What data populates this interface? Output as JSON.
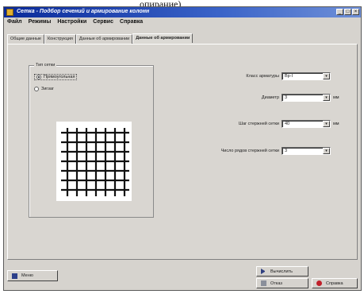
{
  "caption_fragment": "опирание)",
  "window": {
    "title": "Сетка - Подбор сечений и армирование колонн",
    "controls": [
      "_",
      "□",
      "×"
    ]
  },
  "menu": [
    "Файл",
    "Режимы",
    "Настройки",
    "Сервис",
    "Справка"
  ],
  "tabs": [
    {
      "label": "Общие данные",
      "active": false
    },
    {
      "label": "Конструкция",
      "active": false
    },
    {
      "label": "Данные об армировании",
      "active": false
    },
    {
      "label": "Данные об армировании",
      "active": true
    }
  ],
  "grid_type": {
    "label": "Тип сетки",
    "options": [
      {
        "label": "Прямоугольная",
        "checked": true
      },
      {
        "label": "Зигзаг",
        "checked": false
      }
    ]
  },
  "fields": [
    {
      "label": "Класс арматуры",
      "value": "Вр-I",
      "unit": ""
    },
    {
      "label": "Диаметр",
      "value": "3",
      "unit": "мм"
    },
    {
      "label": "Шаг стержней сетки",
      "value": "40",
      "unit": "мм"
    },
    {
      "label": "Число рядов стержней сетки",
      "value": "3",
      "unit": ""
    }
  ],
  "buttons": {
    "exit": "Меню",
    "run": "Вычислить",
    "cancel": "Отказ",
    "help": "Справка"
  },
  "colors": {
    "titlebar": "#0a2a9a",
    "panel": "#d9d6d1"
  }
}
